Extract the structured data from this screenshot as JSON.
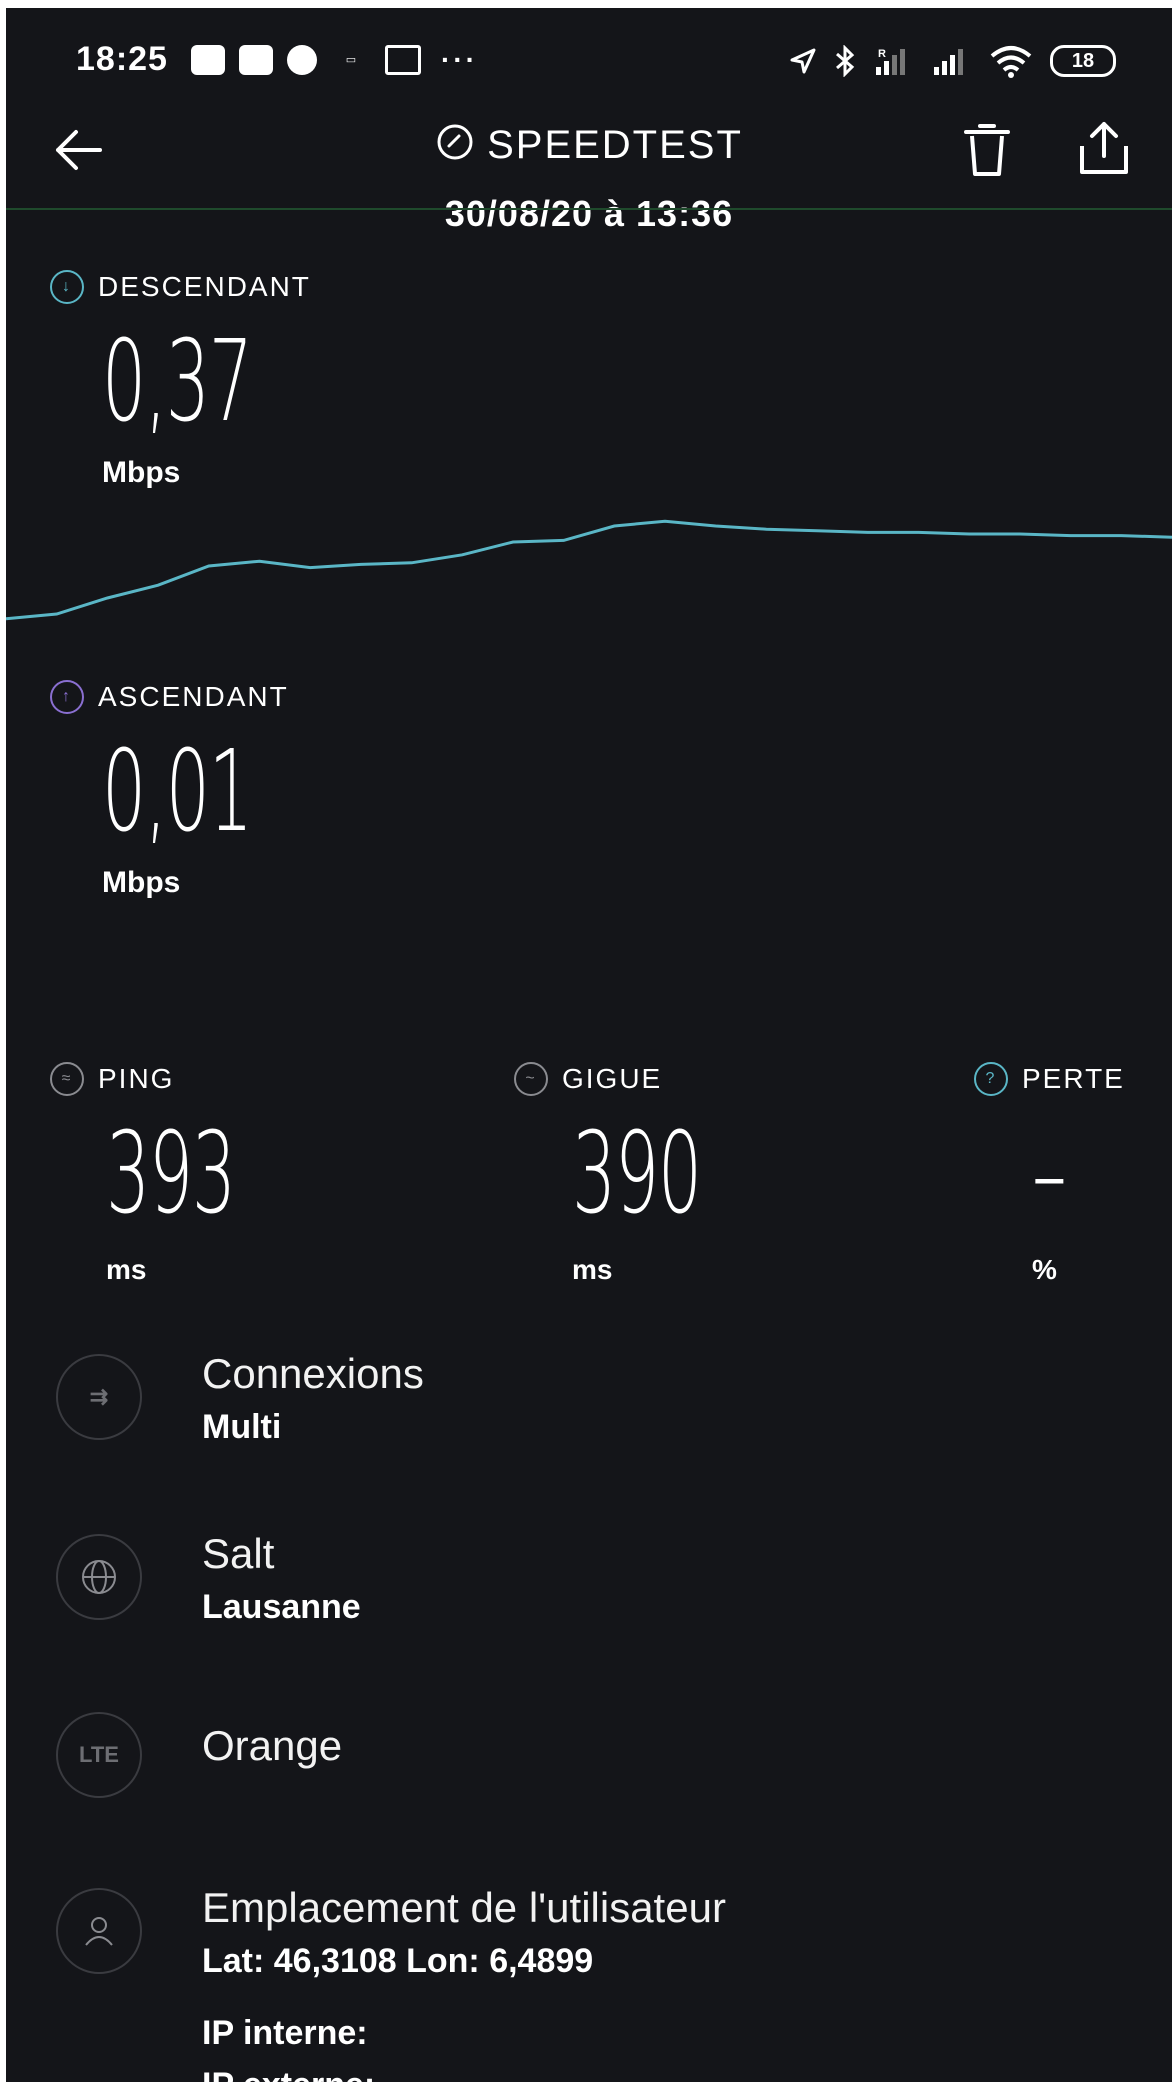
{
  "status_bar": {
    "time": "18:25",
    "more": "···",
    "battery": "18"
  },
  "header": {
    "title": "SPEEDTEST",
    "subtitle": "30/08/20 à 13:36"
  },
  "download": {
    "label": "DESCENDANT",
    "value": "0,37",
    "unit": "Mbps",
    "color": "#5ab6c6"
  },
  "upload": {
    "label": "ASCENDANT",
    "value": "0,01",
    "unit": "Mbps",
    "color": "#8a6fd1"
  },
  "ping": {
    "label": "PING",
    "value": "393",
    "unit": "ms"
  },
  "jitter": {
    "label": "GIGUE",
    "value": "390",
    "unit": "ms"
  },
  "loss": {
    "label": "PERTE",
    "value": "–",
    "unit": "%"
  },
  "connections": {
    "title": "Connexions",
    "value": "Multi"
  },
  "server": {
    "title": "Salt",
    "value": "Lausanne"
  },
  "provider": {
    "icon_text": "LTE",
    "title": "Orange"
  },
  "location": {
    "title": "Emplacement de l'utilisateur",
    "value": "Lat: 46,3108 Lon: 6,4899"
  },
  "ip": {
    "internal": "IP interne:",
    "external": "IP externe:"
  },
  "download_graph": [
    0.12,
    0.15,
    0.25,
    0.33,
    0.45,
    0.48,
    0.44,
    0.46,
    0.47,
    0.52,
    0.6,
    0.61,
    0.7,
    0.73,
    0.7,
    0.68,
    0.67,
    0.66,
    0.66,
    0.65,
    0.65,
    0.64,
    0.64,
    0.63
  ]
}
